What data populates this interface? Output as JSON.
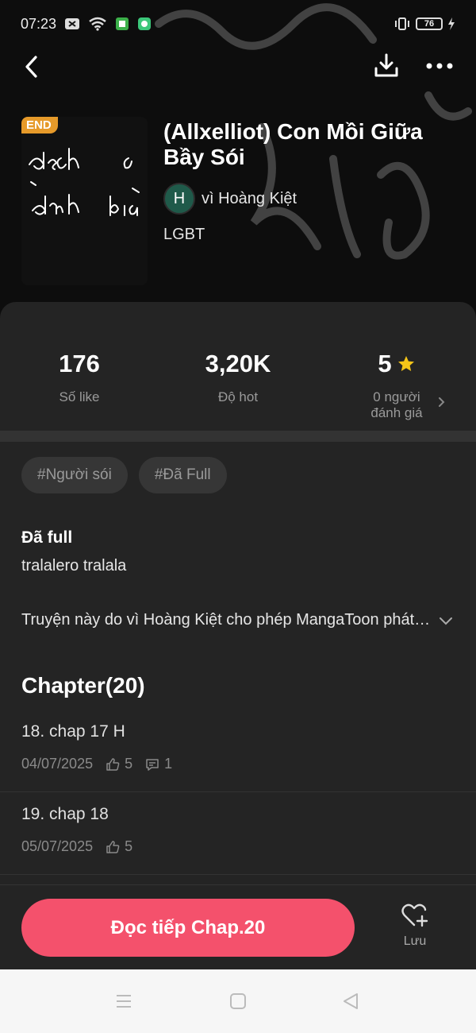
{
  "status_bar": {
    "time": "07:23",
    "battery": "76"
  },
  "book": {
    "end_badge": "END",
    "title": "(Allxelliot) Con Mồi Giữa Bầy Sói",
    "author_initial": "H",
    "author": "vì Hoàng Kiệt",
    "genre": "LGBT"
  },
  "stats": {
    "likes_value": "176",
    "likes_label": "Số like",
    "hot_value": "3,20K",
    "hot_label": "Độ hot",
    "rating_value": "5",
    "rating_label_line1": "0 người",
    "rating_label_line2": "đánh giá"
  },
  "tags": [
    "#Người sói",
    "#Đã Full"
  ],
  "description": {
    "title": "Đã full",
    "text": "tralalero tralala",
    "permission": "Truyện này do vì Hoàng Kiệt cho phép MangaToon phát hành độc quyền"
  },
  "chapters": {
    "heading": "Chapter(20)",
    "items": [
      {
        "title": "18. chap 17 H",
        "date": "04/07/2025",
        "likes": "5",
        "comments": "1"
      },
      {
        "title": "19. chap 18",
        "date": "05/07/2025",
        "likes": "5"
      }
    ]
  },
  "actions": {
    "read_label": "Đọc tiếp Chap.20",
    "save_label": "Lưu"
  },
  "colors": {
    "accent": "#f4516c",
    "badge": "#e69a2a",
    "star": "#f5c518"
  }
}
